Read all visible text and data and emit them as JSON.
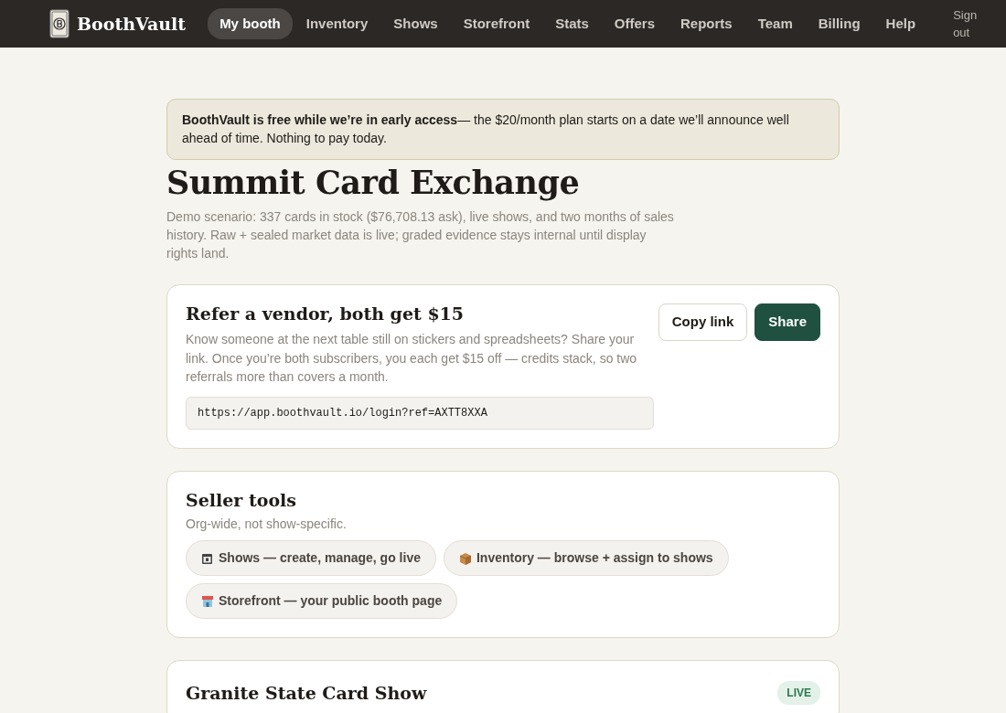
{
  "brand": "BoothVault",
  "nav": [
    {
      "label": "My booth",
      "selected": true
    },
    {
      "label": "Inventory",
      "selected": false
    },
    {
      "label": "Shows",
      "selected": false
    },
    {
      "label": "Storefront",
      "selected": false
    },
    {
      "label": "Stats",
      "selected": false
    },
    {
      "label": "Offers",
      "selected": false
    },
    {
      "label": "Reports",
      "selected": false
    },
    {
      "label": "Team",
      "selected": false
    },
    {
      "label": "Billing",
      "selected": false
    },
    {
      "label": "Help",
      "selected": false
    }
  ],
  "sign_out": "Sign out",
  "notice": "**BoothVault is free while we’re in early access**— the $20/month plan starts on a date we’ll announce well ahead of time. Nothing to pay today.",
  "title": "Summit Card Exchange",
  "subtitle": "Demo scenario: 337 cards in stock ($76,708.13 ask), live shows, and two months of sales history. Raw + sealed market data is live; graded evidence stays internal until display rights land.",
  "referral": {
    "title": "Refer a vendor, both get $15",
    "text": "Know someone at the next table still on stickers and spreadsheets? Share your link. Once you’re both subscribers, you each get $15 off — credits stack, so two referrals more than covers a month.",
    "link": "https://app.boothvault.io/login?ref=AXTT8XXA",
    "buttons": [
      "Copy link",
      "Share"
    ]
  },
  "seller_tools": {
    "title": "Seller tools",
    "subtitle": "Org-wide, not show-specific.",
    "links": [
      {
        "kind": "calendar",
        "label": "Shows — create, manage, go live"
      },
      {
        "kind": "box",
        "label": "Inventory — browse + assign to shows"
      },
      {
        "kind": "store",
        "label": "Storefront — your public booth page"
      }
    ]
  },
  "show": {
    "title": "Granite State Card Show",
    "status": "LIVE"
  }
}
